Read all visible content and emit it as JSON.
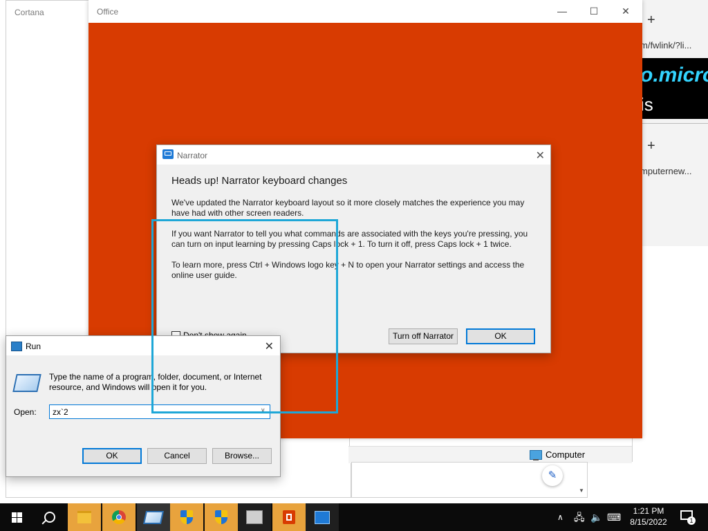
{
  "cortana": {
    "title": "Cortana"
  },
  "browser": {
    "url1": "m/fwlink/?li...",
    "big_text": "o.micro",
    "big_text2": "is",
    "url2": "mputernew..."
  },
  "office": {
    "title": "Office"
  },
  "explorer": {
    "status_item": "Computer"
  },
  "narrator": {
    "title": "Narrator",
    "heading": "Heads up! Narrator keyboard changes",
    "para1": "We've updated the Narrator keyboard layout so it more closely matches the experience you may have had with other screen readers.",
    "para2": "If you want Narrator to tell you what commands are associated with the keys you're pressing, you can turn on input learning by pressing Caps lock + 1. To turn it off, press Caps lock + 1 twice.",
    "para3": "To learn more, press Ctrl + Windows logo key + N to open your Narrator settings and access the online user guide.",
    "checkbox_label": "Don't show again",
    "turn_off_button": "Turn off Narrator",
    "ok_button": "OK"
  },
  "run": {
    "title": "Run",
    "description": "Type the name of a program, folder, document, or Internet resource, and Windows will open it for you.",
    "open_label": "Open:",
    "input_value": "zx`2",
    "ok_button": "OK",
    "cancel_button": "Cancel",
    "browse_button": "Browse..."
  },
  "taskbar": {
    "time": "1:21 PM",
    "date": "8/15/2022",
    "notification_count": "1"
  },
  "colors": {
    "office_accent": "#d83b01",
    "highlight": "#1ea7d7"
  }
}
